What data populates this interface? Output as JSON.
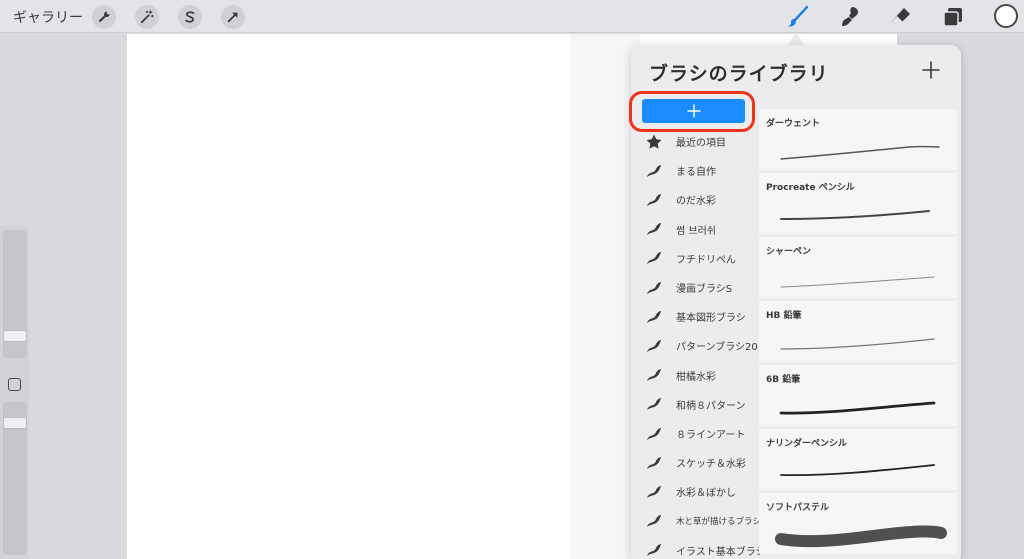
{
  "toolbar": {
    "gallery_label": "ギャラリー",
    "left_tools": [
      {
        "name": "actions",
        "icon": "wrench-icon"
      },
      {
        "name": "adjustments",
        "icon": "magic-wand-icon"
      },
      {
        "name": "selection",
        "icon": "selection-s-icon"
      },
      {
        "name": "transform",
        "icon": "arrow-cursor-icon"
      }
    ],
    "right_tools": [
      {
        "name": "brush",
        "icon": "paintbrush-icon",
        "active": true
      },
      {
        "name": "smudge",
        "icon": "smudge-icon"
      },
      {
        "name": "eraser",
        "icon": "eraser-icon"
      },
      {
        "name": "layers",
        "icon": "layers-icon"
      }
    ],
    "color_value": "#ffffff"
  },
  "colors": {
    "accent_blue": "#1a8cff",
    "highlight_red": "#f2321b",
    "active_tool_blue": "#1a7fe8"
  },
  "brush_library": {
    "title": "ブラシのライブラリ",
    "new_set_icon": "plus-icon",
    "sets": [
      {
        "label": "最近の項目",
        "icon": "star-icon"
      },
      {
        "label": "まる自作",
        "icon": "brush-stroke-icon"
      },
      {
        "label": "のだ水彩",
        "icon": "brush-stroke-icon"
      },
      {
        "label": "썸 브러쉬",
        "icon": "brush-stroke-icon"
      },
      {
        "label": "フチドリぺん",
        "icon": "brush-stroke-icon"
      },
      {
        "label": "漫画ブラシS",
        "icon": "brush-stroke-icon"
      },
      {
        "label": "基本図形ブラシ",
        "icon": "brush-stroke-icon"
      },
      {
        "label": "パターンブラシ20",
        "icon": "brush-stroke-icon"
      },
      {
        "label": "柑橘水彩",
        "icon": "brush-stroke-icon"
      },
      {
        "label": "和柄８パターン",
        "icon": "brush-stroke-icon"
      },
      {
        "label": "８ラインアート",
        "icon": "brush-stroke-icon"
      },
      {
        "label": "スケッチ＆水彩",
        "icon": "brush-stroke-icon"
      },
      {
        "label": "水彩＆ぼかし",
        "icon": "brush-stroke-icon"
      },
      {
        "label": "木と草が描けるブラシ",
        "icon": "brush-stroke-icon"
      },
      {
        "label": "イラスト基本ブラシ",
        "icon": "brush-stroke-icon"
      }
    ],
    "brushes": [
      {
        "name": "ダーウェント"
      },
      {
        "name": "Procreate ペンシル"
      },
      {
        "name": "シャーペン"
      },
      {
        "name": "HB 鉛筆"
      },
      {
        "name": "6B 鉛筆"
      },
      {
        "name": "ナリンダーペンシル"
      },
      {
        "name": "ソフトパステル"
      }
    ]
  }
}
